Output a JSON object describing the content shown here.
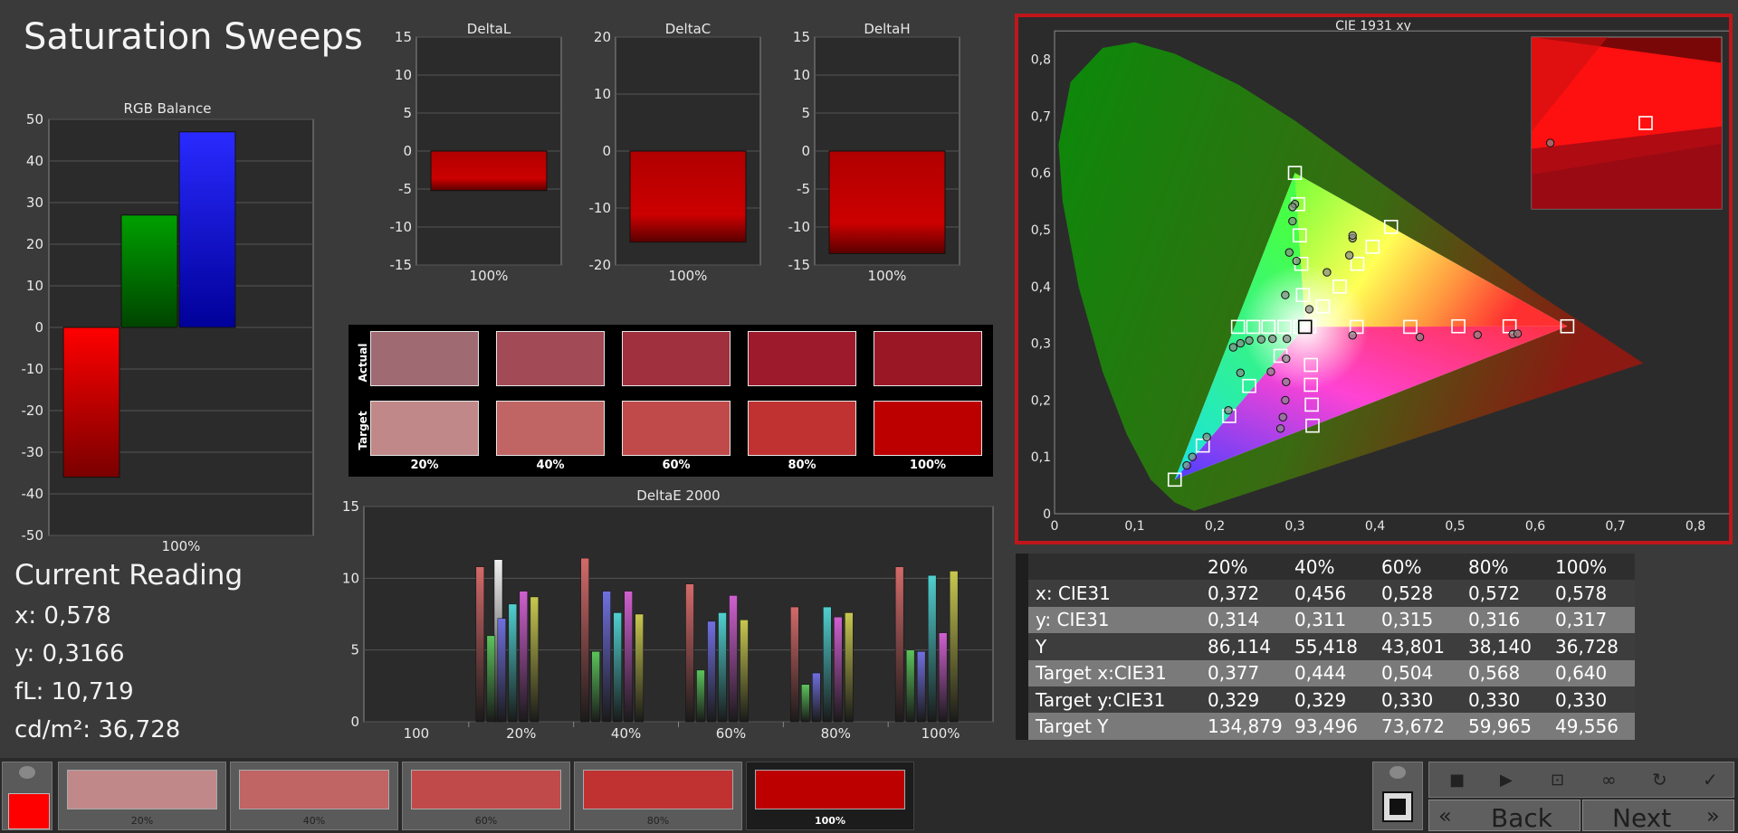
{
  "title": "Saturation Sweeps",
  "rgb_balance": {
    "title": "RGB Balance",
    "xlabel": "100%",
    "ticks": [
      "50",
      "40",
      "30",
      "20",
      "10",
      "0",
      "-10",
      "-20",
      "-30",
      "-40",
      "-50"
    ],
    "ylim": [
      -50,
      50
    ],
    "values": {
      "red": -36,
      "green": 27,
      "blue": 47
    }
  },
  "delta_l": {
    "title": "DeltaL",
    "xlabel": "100%",
    "ticks": [
      "15",
      "10",
      "5",
      "0",
      "-5",
      "-10",
      "-15"
    ],
    "ylim": [
      -15,
      15
    ],
    "value": -5.2
  },
  "delta_c": {
    "title": "DeltaC",
    "xlabel": "100%",
    "ticks": [
      "20",
      "10",
      "0",
      "-10",
      "-20"
    ],
    "ylim": [
      -20,
      20
    ],
    "value": -16
  },
  "delta_h": {
    "title": "DeltaH",
    "xlabel": "100%",
    "ticks": [
      "15",
      "10",
      "5",
      "0",
      "-5",
      "-10",
      "-15"
    ],
    "ylim": [
      -15,
      15
    ],
    "value": -13.5
  },
  "swatches": {
    "actual_label": "Actual",
    "target_label": "Target",
    "labels": [
      "20%",
      "40%",
      "60%",
      "80%",
      "100%"
    ],
    "actual": [
      "#a06a72",
      "#a24a56",
      "#a0303e",
      "#9c1a2c",
      "#9a1826"
    ],
    "target": [
      "#c08888",
      "#c06464",
      "#c04a4a",
      "#c03232",
      "#bc0000"
    ]
  },
  "delta_e": {
    "title": "DeltaE 2000",
    "ticks": [
      "15",
      "10",
      "5",
      "0"
    ],
    "categories": [
      "100",
      "20%",
      "40%",
      "60%",
      "80%",
      "100%"
    ],
    "groups": [
      [
        0,
        0,
        0,
        0,
        0,
        11.3
      ],
      [
        10.8,
        6.0,
        7.2,
        8.2,
        9.1,
        8.7
      ],
      [
        11.4,
        4.9,
        9.1,
        7.6,
        9.1,
        7.5
      ],
      [
        9.6,
        3.6,
        7.0,
        7.6,
        8.8,
        7.1
      ],
      [
        8.0,
        2.6,
        3.4,
        8.0,
        7.3,
        7.6
      ],
      [
        10.8,
        5.0,
        4.9,
        10.2,
        6.2,
        10.5
      ]
    ],
    "colors": [
      "#d46a6a",
      "#5cc45c",
      "#7070e0",
      "#50d0d0",
      "#d060d0",
      "#c8c850"
    ],
    "first_color": "#f0f0f0"
  },
  "cie": {
    "title": "CIE 1931 xy",
    "xticks": [
      "0",
      "0,1",
      "0,2",
      "0,3",
      "0,4",
      "0,5",
      "0,6",
      "0,7",
      "0,8"
    ],
    "yticks": [
      "0,8",
      "0,7",
      "0,6",
      "0,5",
      "0,4",
      "0,3",
      "0,2",
      "0,1",
      "0"
    ],
    "targets": [
      [
        0.3,
        0.6
      ],
      [
        0.304,
        0.545
      ],
      [
        0.306,
        0.49
      ],
      [
        0.308,
        0.44
      ],
      [
        0.31,
        0.385
      ],
      [
        0.313,
        0.33
      ],
      [
        0.15,
        0.06
      ],
      [
        0.185,
        0.12
      ],
      [
        0.218,
        0.172
      ],
      [
        0.243,
        0.225
      ],
      [
        0.282,
        0.278
      ],
      [
        0.318,
        0.33
      ],
      [
        0.32,
        0.262
      ],
      [
        0.32,
        0.227
      ],
      [
        0.321,
        0.192
      ],
      [
        0.322,
        0.155
      ],
      [
        0.229,
        0.329
      ],
      [
        0.248,
        0.329
      ],
      [
        0.267,
        0.329
      ],
      [
        0.287,
        0.329
      ],
      [
        0.307,
        0.329
      ],
      [
        0.335,
        0.365
      ],
      [
        0.356,
        0.4
      ],
      [
        0.378,
        0.44
      ],
      [
        0.397,
        0.47
      ],
      [
        0.42,
        0.505
      ],
      [
        0.377,
        0.329
      ],
      [
        0.444,
        0.329
      ],
      [
        0.504,
        0.33
      ],
      [
        0.568,
        0.33
      ],
      [
        0.64,
        0.33
      ]
    ],
    "actuals": [
      [
        0.3,
        0.545
      ],
      [
        0.297,
        0.54
      ],
      [
        0.297,
        0.515
      ],
      [
        0.293,
        0.46
      ],
      [
        0.302,
        0.445
      ],
      [
        0.288,
        0.385
      ],
      [
        0.318,
        0.36
      ],
      [
        0.165,
        0.085
      ],
      [
        0.172,
        0.1
      ],
      [
        0.19,
        0.135
      ],
      [
        0.217,
        0.182
      ],
      [
        0.232,
        0.248
      ],
      [
        0.27,
        0.25
      ],
      [
        0.289,
        0.273
      ],
      [
        0.289,
        0.232
      ],
      [
        0.288,
        0.2
      ],
      [
        0.285,
        0.17
      ],
      [
        0.282,
        0.15
      ],
      [
        0.223,
        0.293
      ],
      [
        0.232,
        0.3
      ],
      [
        0.243,
        0.305
      ],
      [
        0.258,
        0.307
      ],
      [
        0.272,
        0.308
      ],
      [
        0.29,
        0.308
      ],
      [
        0.34,
        0.425
      ],
      [
        0.368,
        0.455
      ],
      [
        0.372,
        0.485
      ],
      [
        0.372,
        0.49
      ],
      [
        0.372,
        0.314
      ],
      [
        0.456,
        0.311
      ],
      [
        0.528,
        0.315
      ],
      [
        0.572,
        0.316
      ],
      [
        0.578,
        0.317
      ]
    ],
    "zoom_target": [
      0.64,
      0.33
    ],
    "zoom_actual": [
      0.578,
      0.317
    ]
  },
  "current_reading": {
    "heading": "Current Reading",
    "lines": [
      "x: 0,578",
      "y: 0,3166",
      "fL: 10,719",
      "cd/m²: 36,728"
    ]
  },
  "table": {
    "columns": [
      "20%",
      "40%",
      "60%",
      "80%",
      "100%"
    ],
    "rows": [
      {
        "label": "x: CIE31",
        "values": [
          "0,372",
          "0,456",
          "0,528",
          "0,572",
          "0,578"
        ]
      },
      {
        "label": "y: CIE31",
        "values": [
          "0,314",
          "0,311",
          "0,315",
          "0,316",
          "0,317"
        ]
      },
      {
        "label": "Y",
        "values": [
          "86,114",
          "55,418",
          "43,801",
          "38,140",
          "36,728"
        ]
      },
      {
        "label": "Target x:CIE31",
        "values": [
          "0,377",
          "0,444",
          "0,504",
          "0,568",
          "0,640"
        ]
      },
      {
        "label": "Target y:CIE31",
        "values": [
          "0,329",
          "0,329",
          "0,330",
          "0,330",
          "0,330"
        ]
      },
      {
        "label": "Target Y",
        "values": [
          "134,879",
          "93,496",
          "73,672",
          "59,965",
          "49,556"
        ]
      }
    ]
  },
  "bottom": {
    "current_color": "#ff0000",
    "tiles": [
      {
        "label": "20%",
        "color": "#c08888"
      },
      {
        "label": "40%",
        "color": "#c06464"
      },
      {
        "label": "60%",
        "color": "#c04a4a"
      },
      {
        "label": "80%",
        "color": "#c03232"
      },
      {
        "label": "100%",
        "color": "#bc0000"
      }
    ],
    "back_label": "Back",
    "next_label": "Next"
  }
}
